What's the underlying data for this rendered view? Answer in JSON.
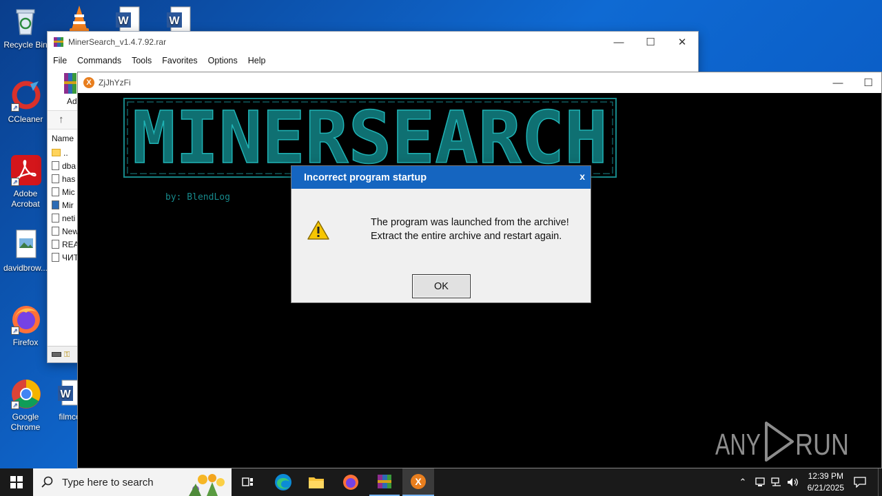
{
  "desktop": {
    "icons": [
      {
        "label": "Recycle Bin"
      },
      {
        "label": "CCleaner"
      },
      {
        "label": "Adobe Acrobat"
      },
      {
        "label": "davidbrow..."
      },
      {
        "label": "Firefox"
      },
      {
        "label": "Google Chrome"
      },
      {
        "label": "filmco"
      }
    ]
  },
  "winrar": {
    "title": "MinerSearch_v1.4.7.92.rar",
    "menu": [
      "File",
      "Commands",
      "Tools",
      "Favorites",
      "Options",
      "Help"
    ],
    "toolbar_label": "Ad",
    "column_name": "Name",
    "files": [
      "..",
      "dba",
      "has",
      "Mic",
      "Mir",
      "neti",
      "New",
      "REA",
      "ЧИТ"
    ]
  },
  "console": {
    "title": "ZjJhYzFi",
    "banner": "MINERSEARCH",
    "byline": "by: BlendLog"
  },
  "dialog": {
    "title": "Incorrect program startup",
    "close": "x",
    "line1": "The program was launched from the archive!",
    "line2": "Extract the entire archive and restart again.",
    "ok": "OK"
  },
  "watermark": {
    "left": "ANY",
    "right": "RUN"
  },
  "taskbar": {
    "search_placeholder": "Type here to search",
    "time": "12:39 PM",
    "date": "6/21/2025"
  },
  "colors": {
    "dialog_title": "#1565c0",
    "banner_teal": "#17898b",
    "taskbar": "#1a1a1a"
  }
}
